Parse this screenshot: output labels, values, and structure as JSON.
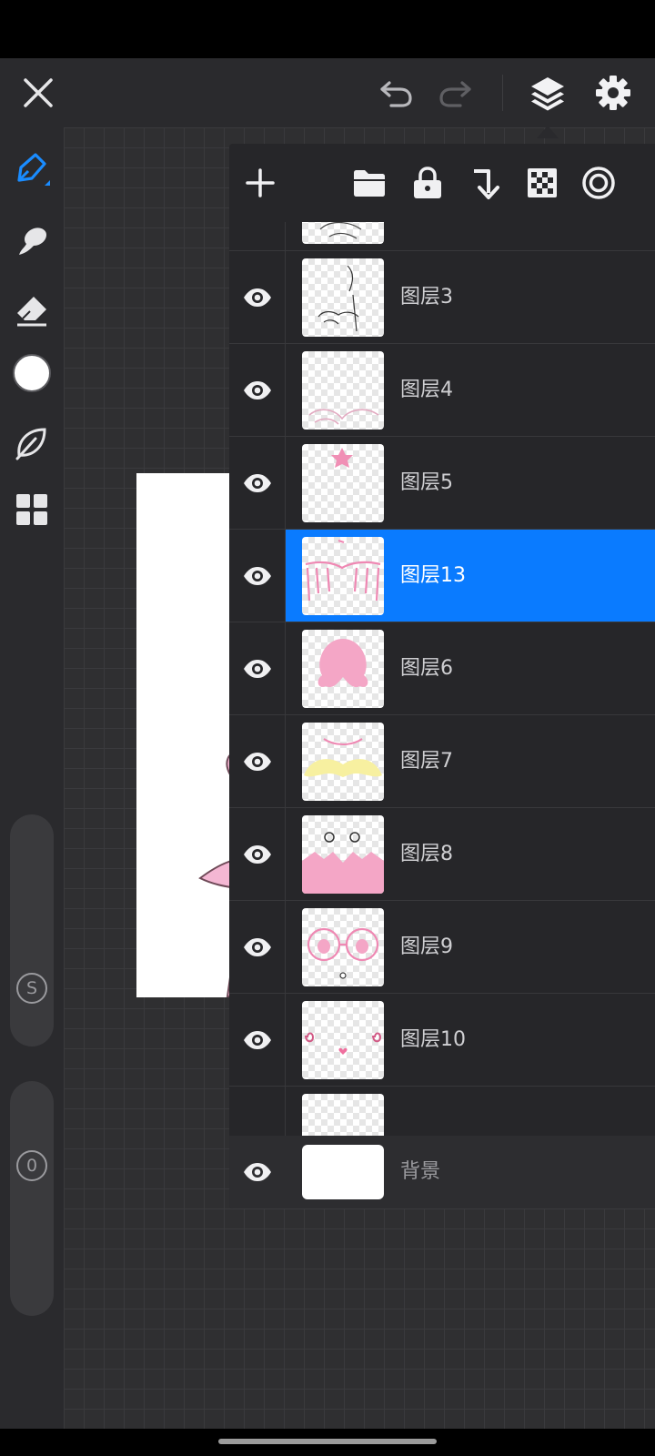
{
  "app": {
    "accent_color": "#0a7bff",
    "selected_layer": "图层13"
  },
  "toolbar": {
    "close_icon": "close-icon",
    "undo_icon": "undo-icon",
    "redo_icon": "redo-icon",
    "layers_icon": "layers-icon",
    "settings_icon": "gear-icon"
  },
  "left_tools": {
    "items": [
      "pen-tool",
      "smudge-tool",
      "eraser-tool",
      "color-picker",
      "leaf-tool",
      "grid-menu"
    ],
    "brush_size_badge": "S",
    "opacity_badge": "0"
  },
  "layers_panel": {
    "header_icons": [
      "add-layer-icon",
      "folder-icon",
      "lock-icon",
      "merge-down-icon",
      "transparency-icon",
      "blend-icon"
    ],
    "layers": [
      {
        "name": "",
        "visible": true
      },
      {
        "name": "图层3",
        "visible": true
      },
      {
        "name": "图层4",
        "visible": true
      },
      {
        "name": "图层5",
        "visible": true
      },
      {
        "name": "图层13",
        "visible": true
      },
      {
        "name": "图层6",
        "visible": true
      },
      {
        "name": "图层7",
        "visible": true
      },
      {
        "name": "图层8",
        "visible": true
      },
      {
        "name": "图层9",
        "visible": true
      },
      {
        "name": "图层10",
        "visible": true
      }
    ],
    "background_layer": {
      "name": "背景",
      "visible": true
    }
  }
}
